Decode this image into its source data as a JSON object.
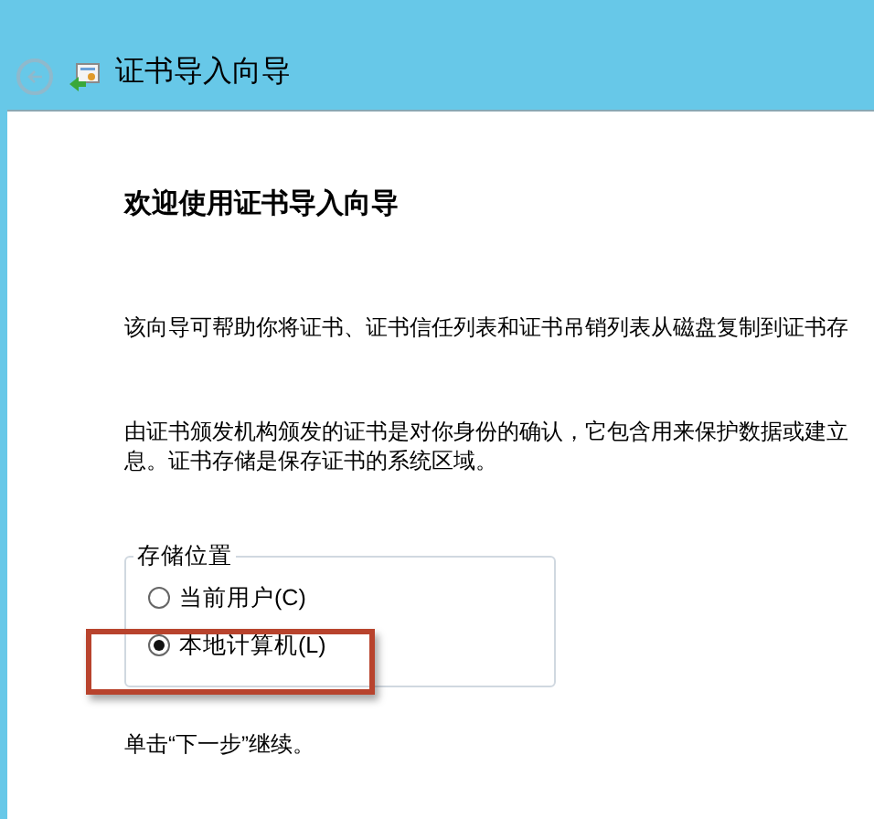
{
  "window": {
    "title": "证书导入向导"
  },
  "heading": "欢迎使用证书导入向导",
  "intro": "该向导可帮助你将证书、证书信任列表和证书吊销列表从磁盘复制到证书存",
  "description_lines": [
    "由证书颁发机构颁发的证书是对你身份的确认，它包含用来保护数据或建立",
    "息。证书存储是保存证书的系统区域。"
  ],
  "store_location": {
    "label": "存储位置",
    "options": [
      {
        "label": "当前用户(C)",
        "selected": false,
        "highlighted": false
      },
      {
        "label": "本地计算机(L)",
        "selected": true,
        "highlighted": true
      }
    ]
  },
  "footer": "单击“下一步”继续。"
}
